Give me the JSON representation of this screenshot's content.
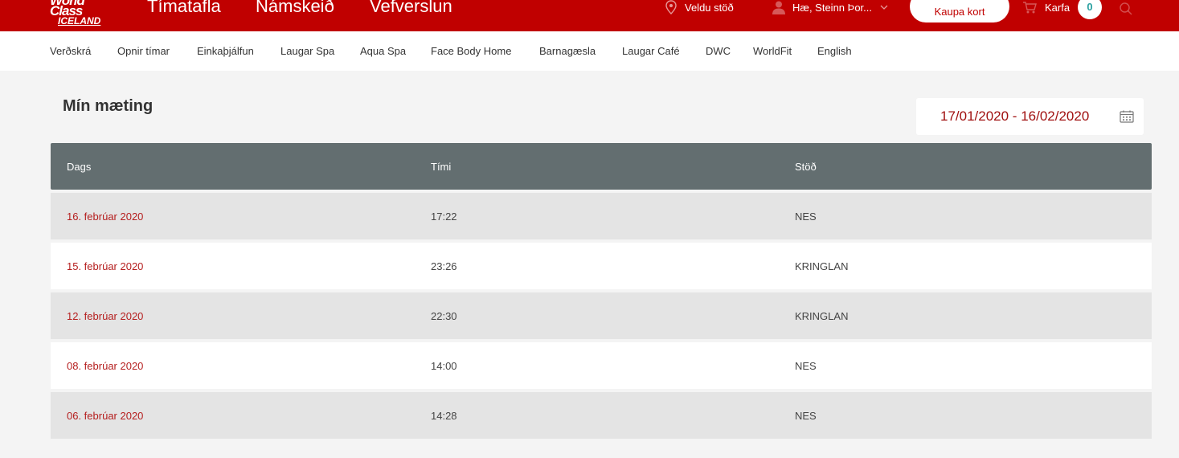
{
  "header": {
    "logo_line1": "World Class",
    "logo_line2": "ICELAND",
    "nav": [
      "Tímatafla",
      "Námskeið",
      "Vefverslun"
    ],
    "station_label": "Veldu stöð",
    "user_label": "Hæ, Steinn Þor...",
    "buy_button": "Kaupa kort",
    "cart_label": "Karfa",
    "cart_count": "0"
  },
  "subnav": [
    "Verðskrá",
    "Opnir tímar",
    "Einkaþjálfun",
    "Laugar Spa",
    "Aqua Spa",
    "Face Body Home",
    "Barnagæsla",
    "Laugar Café",
    "DWC",
    "WorldFit",
    "English"
  ],
  "page": {
    "title": "Mín mæting",
    "date_range": "17/01/2020 - 16/02/2020"
  },
  "table": {
    "headers": [
      "Dags",
      "Tími",
      "Stöð"
    ],
    "rows": [
      [
        "16. febrúar 2020",
        "17:22",
        "NES"
      ],
      [
        "15. febrúar 2020",
        "23:26",
        "KRINGLAN"
      ],
      [
        "12. febrúar 2020",
        "22:30",
        "KRINGLAN"
      ],
      [
        "08. febrúar 2020",
        "14:00",
        "NES"
      ],
      [
        "06. febrúar 2020",
        "14:28",
        "NES"
      ]
    ]
  },
  "colors": {
    "brand": "#c00000",
    "header_row": "#636e70",
    "date_text": "#b51e1e"
  },
  "icons": [
    "map-pin-icon",
    "user-icon",
    "chevron-down-icon",
    "cart-icon",
    "search-icon",
    "calendar-icon"
  ]
}
